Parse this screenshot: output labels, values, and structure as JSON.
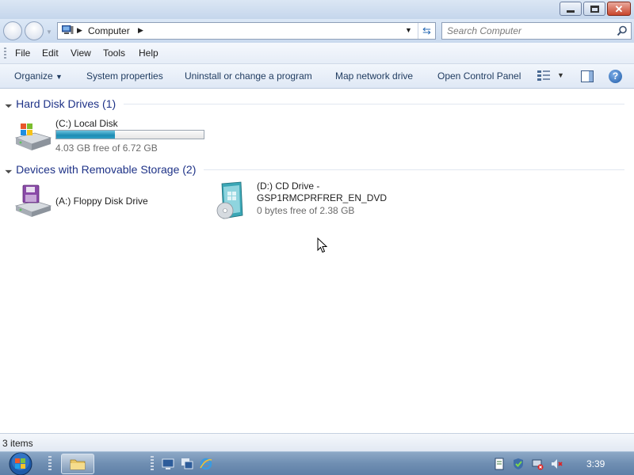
{
  "window": {
    "controls": [
      "minimize-icon",
      "maximize-icon",
      "close-icon"
    ]
  },
  "address": {
    "location": "Computer",
    "search_placeholder": "Search Computer"
  },
  "menu": {
    "items": [
      "File",
      "Edit",
      "View",
      "Tools",
      "Help"
    ]
  },
  "commands": {
    "organize": "Organize",
    "system_properties": "System properties",
    "uninstall": "Uninstall or change a program",
    "map_drive": "Map network drive",
    "control_panel": "Open Control Panel"
  },
  "groups": [
    {
      "label": "Hard Disk Drives (1)",
      "drives": [
        {
          "name": "(C:) Local Disk",
          "free": "4.03 GB free of 6.72 GB",
          "used_fraction": 0.4,
          "icon": "hard-disk-icon"
        }
      ]
    },
    {
      "label": "Devices with Removable Storage (2)",
      "drives": [
        {
          "name": "(A:) Floppy Disk Drive",
          "icon": "floppy-drive-icon"
        },
        {
          "name_line1": "(D:) CD Drive -",
          "name_line2": "GSP1RMCPRFRER_EN_DVD",
          "free": "0 bytes free of 2.38 GB",
          "icon": "cd-drive-icon"
        }
      ]
    }
  ],
  "status": {
    "items_count": "3 items"
  },
  "taskbar": {
    "clock": "3:39"
  },
  "colors": {
    "group_header": "#1e3287",
    "usage_bar": "#1d8bb3",
    "taskbar": "#6f8eb2"
  }
}
